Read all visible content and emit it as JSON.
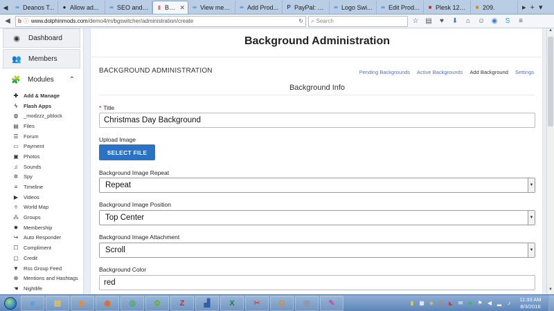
{
  "browser": {
    "tabs": [
      {
        "label": "Deanos T...",
        "icon": "∞",
        "icon_color": "#3e7fd1"
      },
      {
        "label": "Allow ad...",
        "icon": "●",
        "icon_color": "#222222"
      },
      {
        "label": "SEO and ...",
        "icon": "∞",
        "icon_color": "#3e7fd1"
      },
      {
        "label": "Backgr...",
        "icon": "‖",
        "icon_color": "#d22b2b",
        "active": true
      },
      {
        "label": "View mes...",
        "icon": "∞",
        "icon_color": "#3e7fd1"
      },
      {
        "label": "Add Prod...",
        "icon": "∞",
        "icon_color": "#3e7fd1"
      },
      {
        "label": "PayPal: S...",
        "icon": "P",
        "icon_color": "#1d4c9b"
      },
      {
        "label": "Logo Swi...",
        "icon": "∞",
        "icon_color": "#3e7fd1"
      },
      {
        "label": "Edit Prod...",
        "icon": "∞",
        "icon_color": "#3e7fd1"
      },
      {
        "label": "Plesk 12.0...",
        "icon": "■",
        "icon_color": "#c52f2f"
      },
      {
        "label": "209.",
        "icon": "■",
        "icon_color": "#d08a1c"
      }
    ],
    "url_host": "www.dolphinmods.com",
    "url_path": "/demo4/m/bgswitcher/administration/create",
    "search_placeholder": "Search"
  },
  "sidebar": {
    "main_items": [
      {
        "label": "Dashboard",
        "icon": "dashboard-icon",
        "glyph": "◉"
      },
      {
        "label": "Members",
        "icon": "members-icon",
        "glyph": "👥"
      },
      {
        "label": "Modules",
        "icon": "modules-icon",
        "glyph": "🧩"
      }
    ],
    "module_items": [
      {
        "label": "Add & Manage",
        "glyph": "✚",
        "bold": true
      },
      {
        "label": "Flash Apps",
        "glyph": "ϟ",
        "bold": true
      },
      {
        "label": "_modzzz_pblock",
        "glyph": "◍"
      },
      {
        "label": "Files",
        "glyph": "▤"
      },
      {
        "label": "Forum",
        "glyph": "☰"
      },
      {
        "label": "Payment",
        "glyph": "▭"
      },
      {
        "label": "Photos",
        "glyph": "▣"
      },
      {
        "label": "Sounds",
        "glyph": "♫"
      },
      {
        "label": "Spy",
        "glyph": "✲"
      },
      {
        "label": "Timeline",
        "glyph": "≡"
      },
      {
        "label": "Videos",
        "glyph": "▶"
      },
      {
        "label": "World Map",
        "glyph": "⌾"
      },
      {
        "label": "Groups",
        "glyph": "⁂"
      },
      {
        "label": "Membership",
        "glyph": "✹"
      },
      {
        "label": "Auto Responder",
        "glyph": "↪"
      },
      {
        "label": "Compliment",
        "glyph": "☐"
      },
      {
        "label": "Credit",
        "glyph": "▢"
      },
      {
        "label": "Rss Group Feed",
        "glyph": "▼"
      },
      {
        "label": "Mentions and Hashtags",
        "glyph": "⊕"
      },
      {
        "label": "Nightlife",
        "glyph": "☚"
      }
    ]
  },
  "main": {
    "page_title": "Background Administration",
    "section_title": "BACKGROUND ADMINISTRATION",
    "subnav": [
      {
        "label": "Pending Backgrounds"
      },
      {
        "label": "Active Backgrounds"
      },
      {
        "label": "Add Background",
        "current": true
      },
      {
        "label": "Settings"
      }
    ],
    "form_title": "Background Info",
    "form": {
      "title_label": "Title",
      "title_required_mark": "*",
      "title_value": "Christmas Day Background",
      "upload_label": "Upload Image",
      "select_file_label": "SELECT FILE",
      "repeat_label": "Background Image Repeat",
      "repeat_value": "Repeat",
      "position_label": "Background Image Position",
      "position_value": "Top Center",
      "attachment_label": "Background Image Attachment",
      "attachment_value": "Scroll",
      "color_label": "Background Color",
      "color_value": "red"
    }
  },
  "taskbar": {
    "apps": [
      {
        "name": "internet-explorer",
        "glyph": "e",
        "color": "#3aa0e8"
      },
      {
        "name": "file-explorer",
        "glyph": "▤",
        "color": "#e8c15a"
      },
      {
        "name": "media-player",
        "glyph": "▶",
        "color": "#f08a24"
      },
      {
        "name": "firefox",
        "glyph": "◉",
        "color": "#e96a1d"
      },
      {
        "name": "chrome",
        "glyph": "◎",
        "color": "#3fae49"
      },
      {
        "name": "frog-app",
        "glyph": "✿",
        "color": "#6bb03a"
      },
      {
        "name": "filezilla",
        "glyph": "Z",
        "color": "#c9282a"
      },
      {
        "name": "remote-desktop",
        "glyph": "▟",
        "color": "#2f5fa6"
      },
      {
        "name": "excel",
        "glyph": "X",
        "color": "#1f7a3e"
      },
      {
        "name": "snipping-tool",
        "glyph": "✂",
        "color": "#d24b4b"
      },
      {
        "name": "outlook",
        "glyph": "O",
        "color": "#e68a1c"
      },
      {
        "name": "calculator",
        "glyph": "▦",
        "color": "#8c9aa8"
      },
      {
        "name": "paint",
        "glyph": "✎",
        "color": "#c94f9b"
      }
    ],
    "time": "11:33 AM",
    "date": "8/3/2016"
  }
}
